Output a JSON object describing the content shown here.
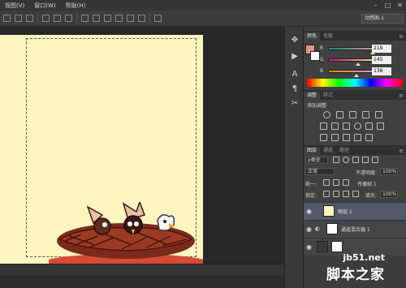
{
  "menubar": {
    "items": [
      "视图(V)",
      "窗口(W)",
      "帮助(H)"
    ],
    "controls": {
      "minimize": "–",
      "maximize": "□",
      "close": "✕"
    }
  },
  "options": {
    "workspace": "动感图-1"
  },
  "tools_strip": {
    "icons": [
      "move-tool-icon",
      "play-icon",
      "type-tool-icon",
      "paragraph-icon",
      "transform-icon"
    ]
  },
  "color_panel": {
    "tabs": [
      "颜色",
      "色板"
    ],
    "fg_color": "#e8948a",
    "bg_color": "#ffffff",
    "sliders": [
      {
        "label": "R",
        "value": "219",
        "pos": 0.86
      },
      {
        "label": "G",
        "value": "145",
        "pos": 0.57
      },
      {
        "label": "B",
        "value": "138",
        "pos": 0.54
      }
    ]
  },
  "adjust_panel": {
    "tabs": [
      "调整",
      "样式"
    ],
    "title": "添加调整"
  },
  "layers_panel": {
    "tabs": [
      "图层",
      "通道",
      "路径"
    ],
    "kind_filter": "ρ类型",
    "blend_mode": "正常",
    "opacity_label": "不透明度:",
    "opacity_value": "100%",
    "unify_label": "统一:",
    "propagate_label": "传播帧 1",
    "lock_label": "锁定:",
    "fill_label": "填充:",
    "fill_value": "100%",
    "layers": [
      {
        "name": "图层 1",
        "selected": true
      },
      {
        "name": "通道混合器 1",
        "selected": false
      },
      {
        "name": "",
        "selected": false
      }
    ]
  },
  "watermark": {
    "line1": "jb51.net",
    "line2": "脚本之家"
  }
}
